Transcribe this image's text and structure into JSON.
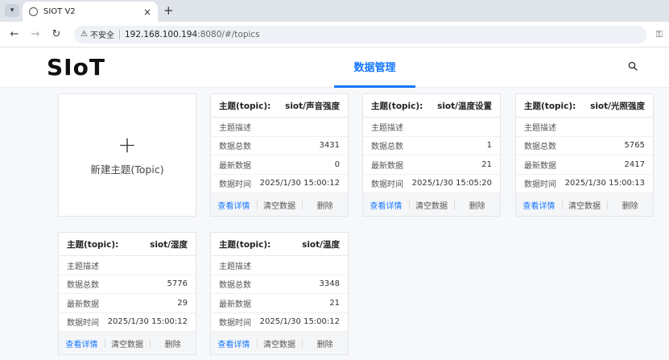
{
  "browser": {
    "tab_title": "SIOT V2",
    "tab_close": "×",
    "new_tab": "+",
    "security_label": "不安全",
    "url_host": "192.168.100.194",
    "url_path": ":8080/#/topics"
  },
  "app": {
    "logo_s": "S",
    "logo_i": "I",
    "logo_o": "o",
    "logo_t": "T",
    "nav_tab": "数据管理"
  },
  "new_topic": {
    "plus": "+",
    "label": "新建主题(Topic)"
  },
  "row_labels": {
    "desc": "主题描述",
    "total": "数据总数",
    "latest": "最新数据",
    "time": "数据时间"
  },
  "actions": {
    "details": "查看详情",
    "clear": "清空数据",
    "delete": "删除"
  },
  "topics": [
    {
      "head": "主题(topic):",
      "name": "siot/声音强度",
      "total": "3431",
      "latest": "0",
      "time": "2025/1/30 15:00:12"
    },
    {
      "head": "主题(topic):",
      "name": "siot/温度设置",
      "total": "1",
      "latest": "21",
      "time": "2025/1/30 15:05:20"
    },
    {
      "head": "主题(topic):",
      "name": "siot/光照强度",
      "total": "5765",
      "latest": "2417",
      "time": "2025/1/30 15:00:13"
    },
    {
      "head": "主题(topic):",
      "name": "siot/湿度",
      "total": "5776",
      "latest": "29",
      "time": "2025/1/30 15:00:12"
    },
    {
      "head": "主题(topic):",
      "name": "siot/温度",
      "total": "3348",
      "latest": "21",
      "time": "2025/1/30 15:00:12"
    }
  ]
}
